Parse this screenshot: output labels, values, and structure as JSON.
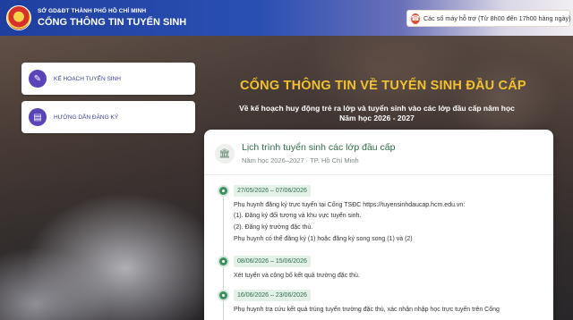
{
  "header": {
    "department": "SỞ GD&ĐT THÀNH PHỐ HỒ CHÍ MINH",
    "portal_name": "CỔNG THÔNG TIN TUYỂN SINH",
    "hotline_label": "Các số máy hỗ trợ (Từ 8h00 đến 17h00 hàng ngày)",
    "hotline_icon": "phone-icon"
  },
  "nav": {
    "items": [
      {
        "label": "KẾ HOẠCH TUYỂN SINH",
        "icon": "document-icon"
      },
      {
        "label": "HƯỚNG DẪN ĐĂNG KÝ",
        "icon": "book-icon"
      }
    ]
  },
  "hero": {
    "title": "CỔNG THÔNG TIN VỀ TUYỂN SINH ĐẦU CẤP",
    "subtitle_line1": "Về kế hoạch huy động trẻ ra lớp và tuyển sinh vào các lớp đầu cấp năm học",
    "subtitle_line2": "Năm học 2026 - 2027"
  },
  "schedule": {
    "title": "Lịch trình tuyển sinh các lớp đầu cấp",
    "subtitle": "Năm học 2026–2027 · TP. Hồ Chí Minh",
    "events": [
      {
        "date": "27/05/2026 – 07/06/2026",
        "lines": [
          "Phụ huynh đăng ký trực tuyến tại Cổng TSĐC https://tuyensinhdaucap.hcm.edu.vn:",
          "(1). Đăng ký đối tượng và khu vực tuyển sinh.",
          "(2). Đăng ký trường đặc thù.",
          "Phụ huynh có thể đăng ký (1) hoặc đăng ký song song (1) và (2)"
        ]
      },
      {
        "date": "08/06/2026 – 15/06/2026",
        "lines": [
          "Xét tuyển và công bố kết quả trường đặc thù."
        ]
      },
      {
        "date": "16/06/2026 – 23/06/2026",
        "lines": [
          "Phụ huynh tra cứu kết quả trúng tuyển trường đặc thù, xác nhận nhập học trực tuyến trên Cổng"
        ]
      }
    ]
  }
}
